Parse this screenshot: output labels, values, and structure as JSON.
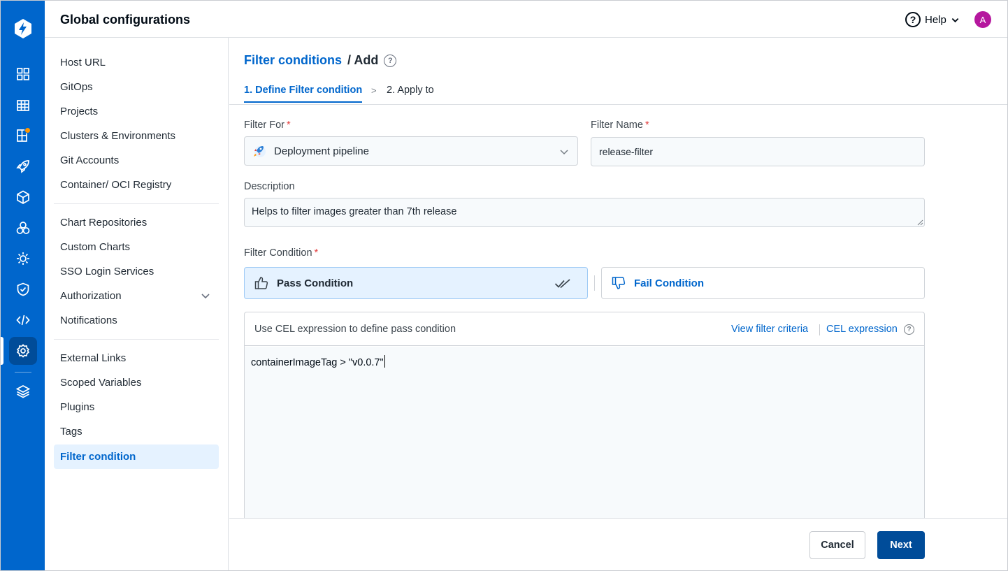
{
  "header": {
    "title": "Global configurations",
    "help_label": "Help",
    "avatar_initial": "A"
  },
  "rail": {
    "icons": [
      "app-logo-icon",
      "overview-grid-icon",
      "applications-icon",
      "app-groups-icon",
      "deploy-rocket-icon",
      "cube-icon",
      "chart-store-icon",
      "security-gear-icon",
      "shield-icon",
      "code-icon",
      "settings-gear-icon",
      "layers-icon"
    ],
    "accent_color": "#0066cc",
    "active_bg_color": "#004c99",
    "notification_dot_color": "#ff9500"
  },
  "sidebar": {
    "items": [
      {
        "label": "Host URL"
      },
      {
        "label": "GitOps"
      },
      {
        "label": "Projects"
      },
      {
        "label": "Clusters & Environments"
      },
      {
        "label": "Git Accounts"
      },
      {
        "label": "Container/ OCI Registry"
      },
      {
        "label": "Chart Repositories"
      },
      {
        "label": "Custom Charts"
      },
      {
        "label": "SSO Login Services"
      },
      {
        "label": "Authorization"
      },
      {
        "label": "Notifications"
      },
      {
        "label": "External Links"
      },
      {
        "label": "Scoped Variables"
      },
      {
        "label": "Plugins"
      },
      {
        "label": "Tags"
      },
      {
        "label": "Filter condition"
      }
    ],
    "active_item": "Filter condition"
  },
  "main": {
    "breadcrumb": {
      "link": "Filter conditions",
      "current": "/ Add"
    },
    "tabs": [
      {
        "label": "1. Define Filter condition"
      },
      {
        "label": "2. Apply to"
      }
    ],
    "tab_separator": ">",
    "form": {
      "filter_for_label": "Filter For",
      "filter_for_value": "Deployment pipeline",
      "filter_name_label": "Filter Name",
      "filter_name_value": "release-filter",
      "description_label": "Description",
      "description_value": "Helps to filter images greater than 7th release",
      "required_mark": "*",
      "condition_label": "Filter Condition",
      "pass_label": "Pass Condition",
      "fail_label": "Fail Condition"
    },
    "editor": {
      "hint": "Use CEL expression to define pass condition",
      "link_view_criteria": "View filter criteria",
      "link_cel": "CEL expression",
      "code": "containerImageTag > \"v0.0.7\""
    },
    "footer": {
      "cancel_label": "Cancel",
      "next_label": "Next"
    }
  }
}
